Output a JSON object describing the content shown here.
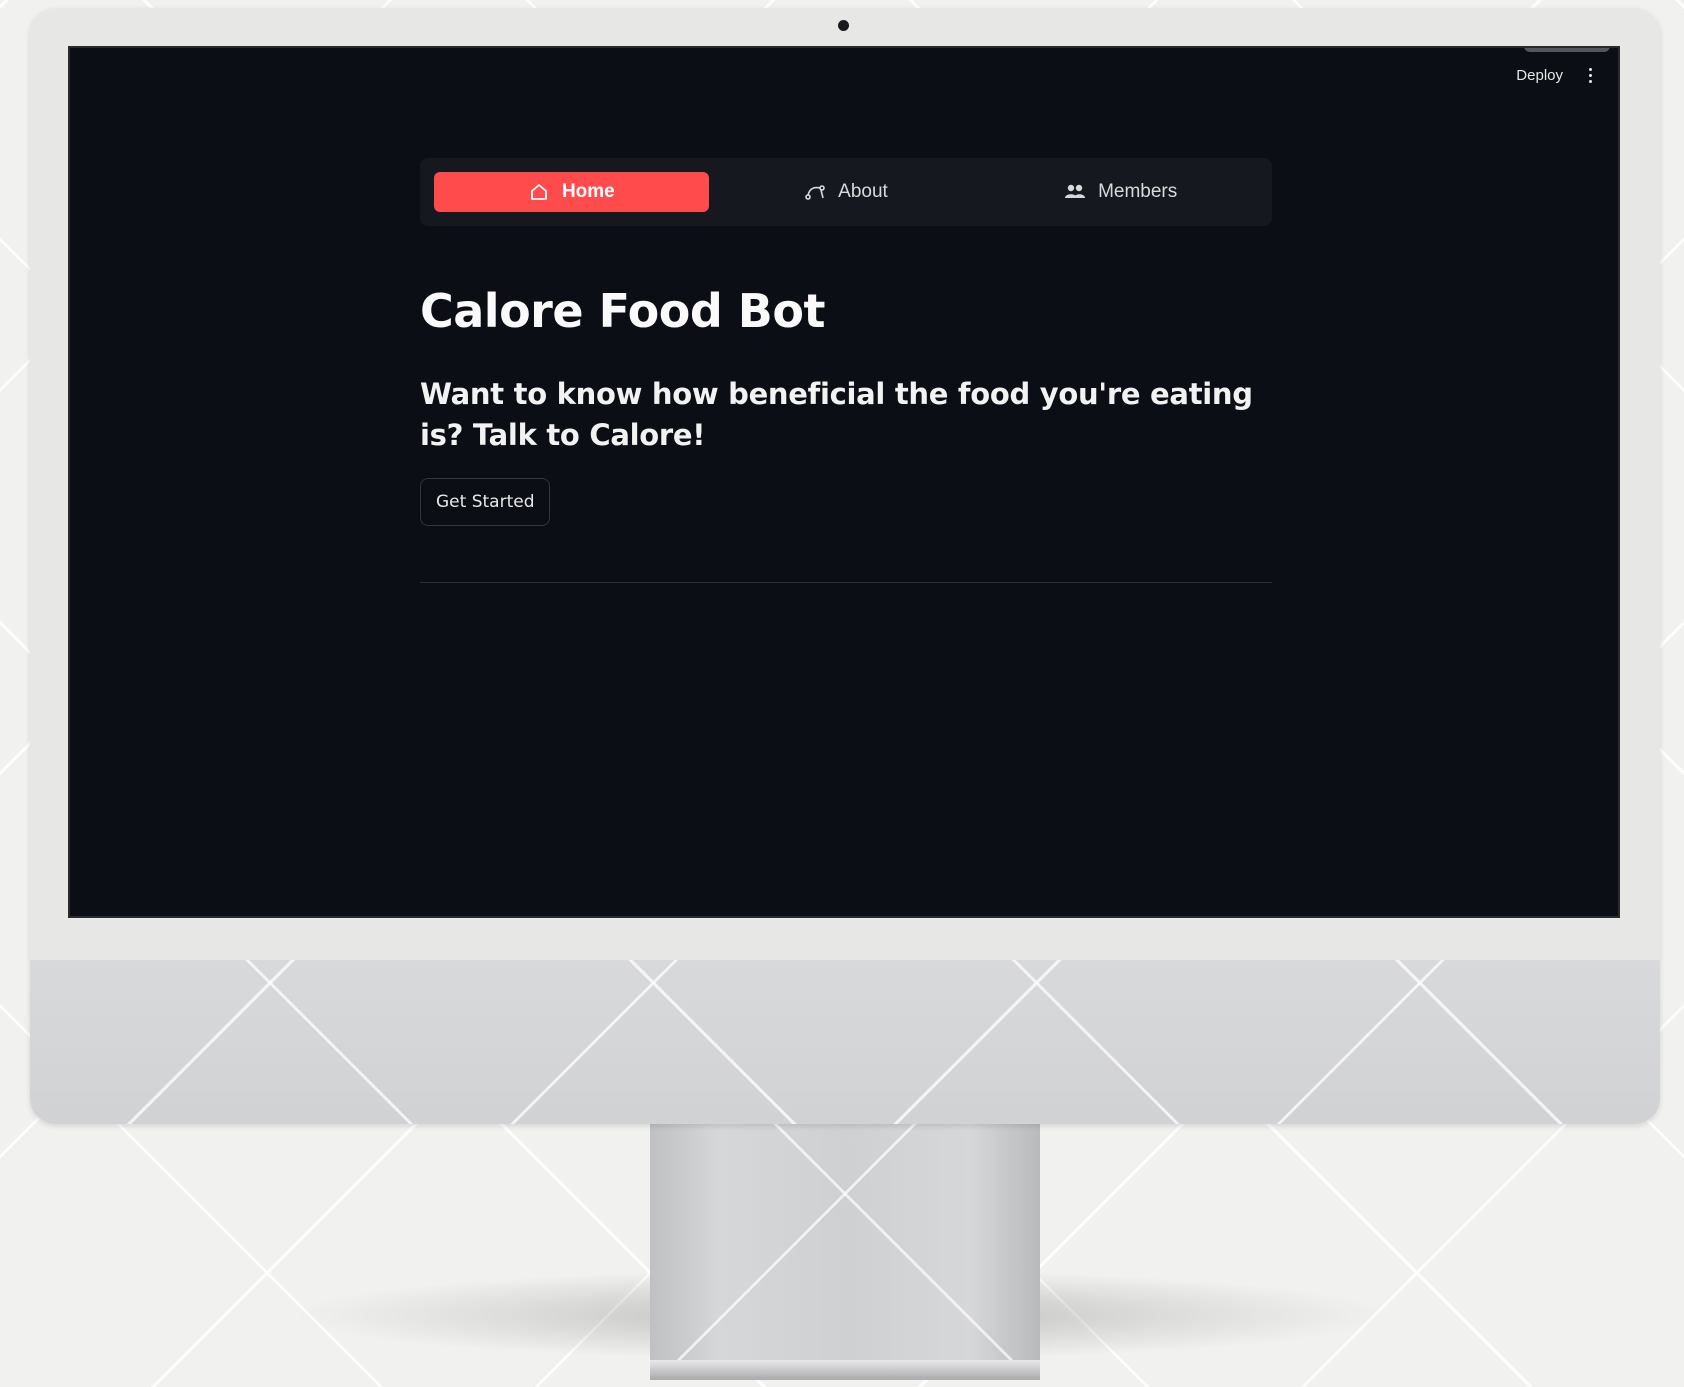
{
  "toolbar": {
    "deploy_label": "Deploy"
  },
  "nav": {
    "items": [
      {
        "label": "Home",
        "icon": "home-icon",
        "active": true
      },
      {
        "label": "About",
        "icon": "route-icon",
        "active": false
      },
      {
        "label": "Members",
        "icon": "people-icon",
        "active": false
      }
    ]
  },
  "main": {
    "title": "Calore Food Bot",
    "subtitle": "Want to know how beneficial the food you're eating is? Talk to Calore!",
    "cta_label": "Get Started"
  },
  "colors": {
    "accent": "#ff4b4b",
    "app_background": "#0b0e14",
    "nav_background": "#16181f"
  }
}
